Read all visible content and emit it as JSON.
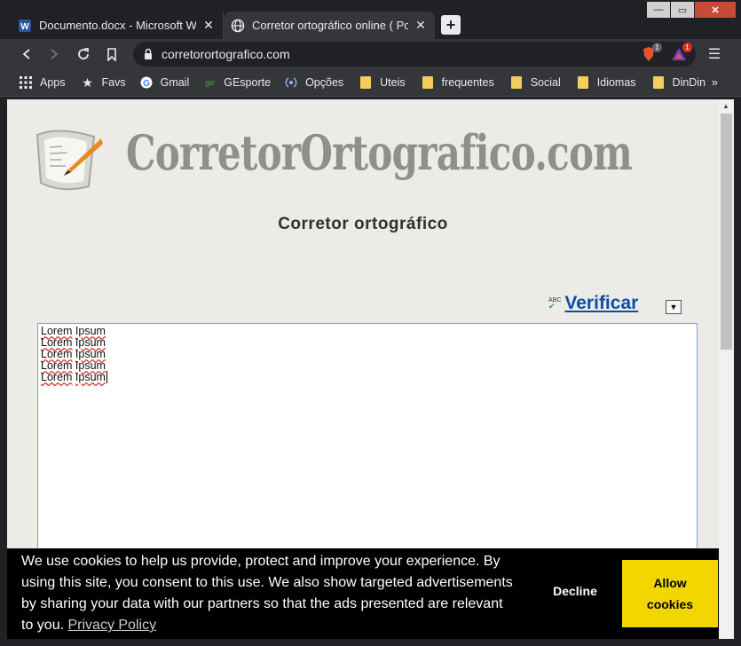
{
  "browser": {
    "tabs": [
      {
        "title": "Documento.docx - Microsoft Word",
        "favicon": "word-icon",
        "active": false
      },
      {
        "title": "Corretor ortográfico online ( Português",
        "favicon": "globe-icon",
        "active": true
      }
    ],
    "new_tab": "+",
    "window_controls": {
      "minimize": "—",
      "maximize": "▭",
      "close": "✕"
    },
    "address": "corretorortografico.com",
    "extensions": [
      {
        "name": "brave-shield-icon",
        "badge": "1"
      },
      {
        "name": "brave-rewards-icon",
        "badge": "1"
      }
    ],
    "menu": "☰",
    "bookmarks": [
      {
        "label": "Apps",
        "icon": "apps-grid-icon"
      },
      {
        "label": "Favs",
        "icon": "star-icon"
      },
      {
        "label": "Gmail",
        "icon": "google-icon"
      },
      {
        "label": "GEsporte",
        "icon": "ge-icon"
      },
      {
        "label": "Opções",
        "icon": "options-icon"
      },
      {
        "label": "Uteis",
        "icon": "folder-icon"
      },
      {
        "label": "frequentes",
        "icon": "folder-icon"
      },
      {
        "label": "Social",
        "icon": "folder-icon"
      },
      {
        "label": "Idiomas",
        "icon": "folder-icon"
      },
      {
        "label": "DinDin",
        "icon": "folder-icon"
      }
    ],
    "bookmarks_more": "»"
  },
  "page": {
    "logo_text": "CorretorOrtografico.com",
    "title": "Corretor ortográfico",
    "verify_abc": "ABC",
    "verify_label": "Verificar",
    "editor_lines": [
      {
        "word1": "Lorem",
        "word2": "Ipsum"
      },
      {
        "word1": "Lorem",
        "word2": "Ipsum"
      },
      {
        "word1": "Lorem",
        "word2": "Ipsum"
      },
      {
        "word1": "Lorem",
        "word2": "Ipsum"
      },
      {
        "word1": "Lorem",
        "word2": "Ipsum"
      }
    ]
  },
  "cookie_banner": {
    "message": "We use cookies to help us provide, protect and improve your experience. By using this site, you consent to this use. We also show targeted advertisements by sharing your data with our partners so that the ads presented are relevant to you.",
    "policy_link": "Privacy Policy",
    "decline": "Decline",
    "allow_line1": "Allow",
    "allow_line2": "cookies"
  },
  "colors": {
    "chrome_dark": "#202124",
    "toolbar": "#35363a",
    "page_bg": "#ecebe7",
    "link_blue": "#0a4ea8",
    "allow_yellow": "#f1d600"
  }
}
